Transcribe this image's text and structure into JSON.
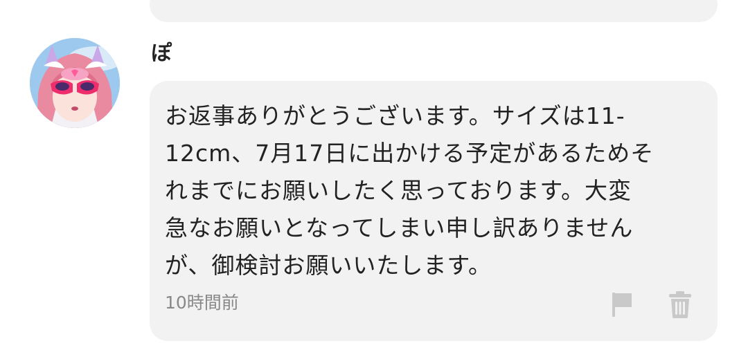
{
  "comment": {
    "username": "ぽ",
    "message": "お返事ありがとうございます。サイズは11-\n12cm、7月17日に出かける予定があるためそ\nれまでにお願いしたく思っております。大変\n急なお願いとなってしまい申し訳ありません\nが、御検討お願いいたします。",
    "timestamp": "10時間前",
    "actions": [
      {
        "icon": "flag-icon"
      },
      {
        "icon": "trash-icon"
      }
    ]
  },
  "colors": {
    "bubble_bg": "#f2f2f2",
    "text": "#222222",
    "muted": "#888888",
    "icon": "#c9c9c9"
  }
}
